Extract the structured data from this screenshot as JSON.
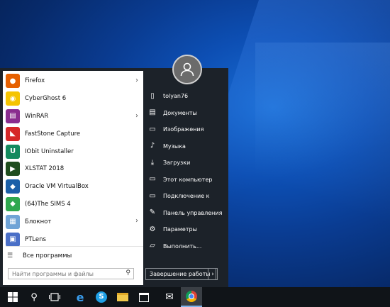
{
  "user": {
    "name": "tolyan76"
  },
  "programs": [
    {
      "label": "Firefox",
      "icon": "firefox-icon",
      "color": "#e66000",
      "glyph": "●",
      "submenu": true
    },
    {
      "label": "CyberGhost 6",
      "icon": "cyberghost-icon",
      "color": "#f5c400",
      "glyph": "◉",
      "submenu": false
    },
    {
      "label": "WinRAR",
      "icon": "winrar-icon",
      "color": "#8a2d8f",
      "glyph": "▤",
      "submenu": true
    },
    {
      "label": "FastStone Capture",
      "icon": "faststone-capture-icon",
      "color": "#d62828",
      "glyph": "◣",
      "submenu": false
    },
    {
      "label": "IObit Uninstaller",
      "icon": "iobit-uninstaller-icon",
      "color": "#138a5e",
      "glyph": "U",
      "submenu": false
    },
    {
      "label": "XLSTAT 2018",
      "icon": "xlstat-icon",
      "color": "#1f4d1f",
      "glyph": "▶",
      "submenu": false
    },
    {
      "label": "Oracle VM VirtualBox",
      "icon": "virtualbox-icon",
      "color": "#1b5fa8",
      "glyph": "◆",
      "submenu": false
    },
    {
      "label": "(64)The SIMS 4",
      "icon": "sims-icon",
      "color": "#2fa84f",
      "glyph": "◆",
      "submenu": false
    },
    {
      "label": "Блокнот",
      "icon": "notepad-icon",
      "color": "#6fa3d6",
      "glyph": "▦",
      "submenu": true
    },
    {
      "label": "PTLens",
      "icon": "ptlens-icon",
      "color": "#4a6fc7",
      "glyph": "▣",
      "submenu": false
    }
  ],
  "all_programs_label": "Все программы",
  "search": {
    "placeholder": "Найти программы и файлы"
  },
  "places": [
    {
      "label": "tolyan76",
      "icon": "user-folder-icon",
      "glyph": "▯"
    },
    {
      "label": "Документы",
      "icon": "documents-icon",
      "glyph": "▤"
    },
    {
      "label": "Изображения",
      "icon": "pictures-icon",
      "glyph": "▭"
    },
    {
      "label": "Музыка",
      "icon": "music-icon",
      "glyph": "♪"
    },
    {
      "label": "Загрузки",
      "icon": "downloads-icon",
      "glyph": "⤓"
    },
    {
      "label": "Этот компьютер",
      "icon": "computer-icon",
      "glyph": "▭"
    },
    {
      "label": "Подключение к",
      "icon": "connect-icon",
      "glyph": "▭"
    },
    {
      "label": "Панель управления",
      "icon": "control-panel-icon",
      "glyph": "✎"
    },
    {
      "label": "Параметры",
      "icon": "settings-icon",
      "glyph": "⚙"
    },
    {
      "label": "Выполнить...",
      "icon": "run-icon",
      "glyph": "▱"
    }
  ],
  "shutdown_label": "Завершение работы",
  "colors": {
    "accent": "#0078d7",
    "menu_bg": "#1c2229",
    "taskbar_bg": "#101418"
  }
}
